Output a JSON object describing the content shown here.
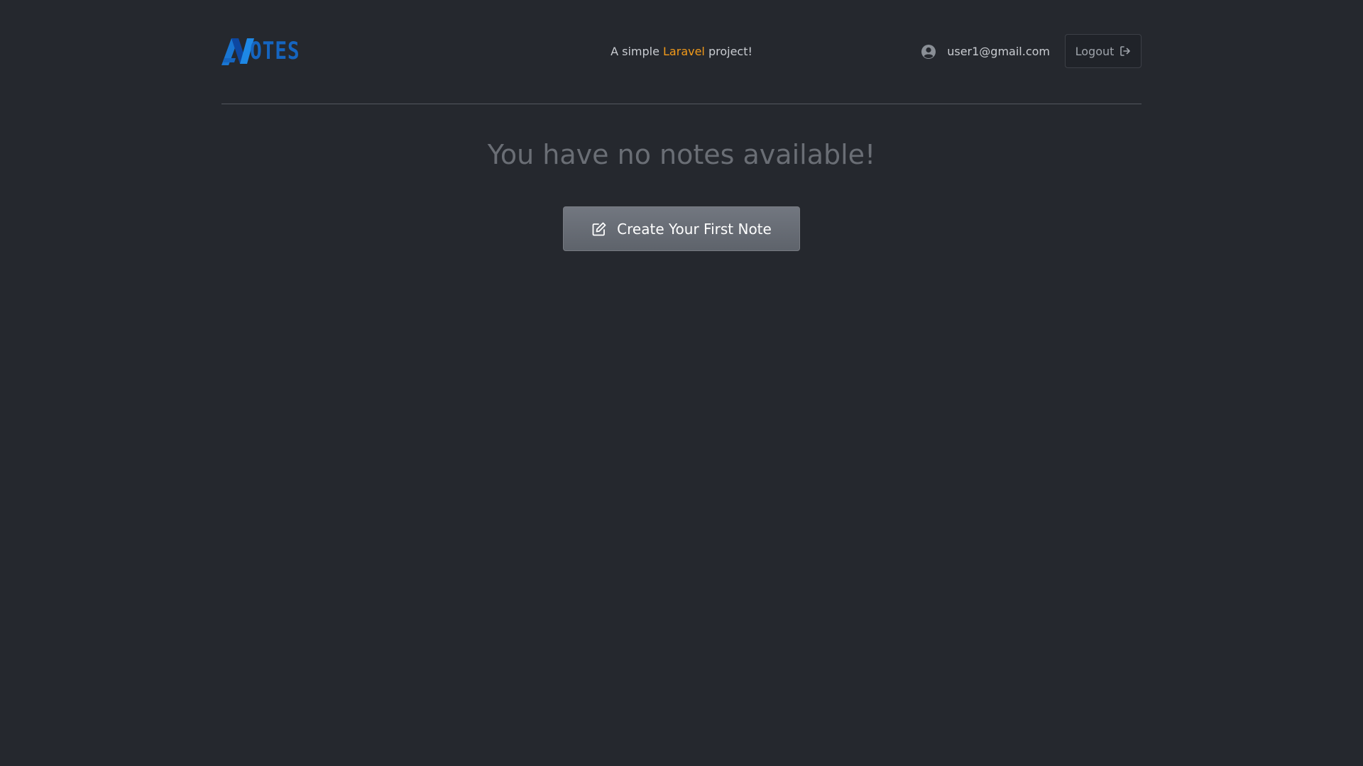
{
  "header": {
    "logo_text": "OTES",
    "tagline_prefix": "A simple ",
    "tagline_highlight": "Laravel",
    "tagline_suffix": " project!",
    "user_email": "user1@gmail.com",
    "logout_label": "Logout"
  },
  "main": {
    "empty_message": "You have no notes available!",
    "create_button_label": "Create Your First Note"
  },
  "colors": {
    "background": "#25282e",
    "brand": "#1565c0",
    "highlight": "#f29a1a"
  },
  "icons": {
    "user": "user-circle-icon",
    "logout": "logout-icon",
    "create": "edit-icon"
  }
}
